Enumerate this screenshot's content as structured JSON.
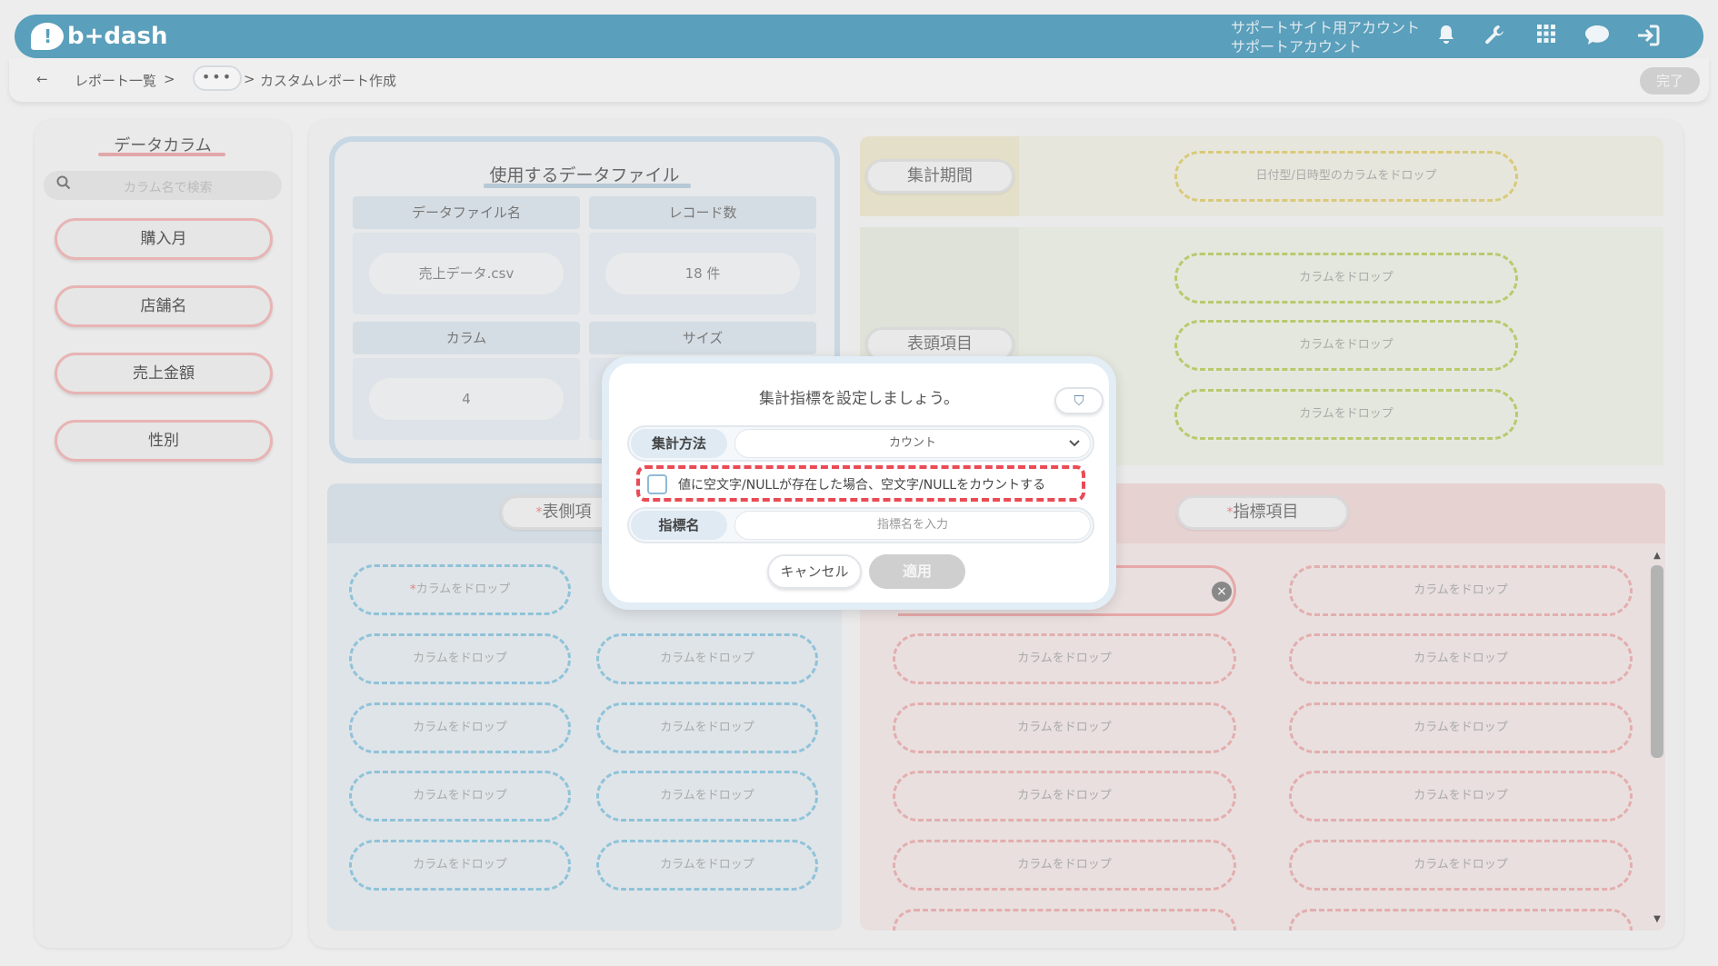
{
  "header": {
    "logo_text": "b+dash",
    "account_line1": "サポートサイト用アカウント",
    "account_line2": "サポートアカウント",
    "icons": [
      "bell-icon",
      "wrench-icon",
      "grid-icon",
      "chat-icon",
      "logout-icon"
    ],
    "brand_color": "#5a9fbb"
  },
  "breadcrumb": {
    "back_glyph": "←",
    "item1": "レポート一覧",
    "sep1": ">",
    "dots": "•••",
    "sep2": ">",
    "current": "カスタムレポート作成",
    "done_label": "完了"
  },
  "left_panel": {
    "title": "データカラム",
    "search_placeholder": "カラム名で検索",
    "columns": [
      "購入月",
      "店舗名",
      "売上金額",
      "性別"
    ]
  },
  "file_box": {
    "title": "使用するデータファイル",
    "head_filename": "データファイル名",
    "head_records": "レコード数",
    "filename": "売上データ.csv",
    "records": "18 件",
    "head_columns": "カラム",
    "head_size": "サイズ",
    "columns": "4"
  },
  "period": {
    "label": "集計期間",
    "drop_text": "日付型/日時型のカラムをドロップ"
  },
  "header_items": {
    "label": "表頭項目",
    "drop_text": "カラムをドロップ"
  },
  "row_items": {
    "required_mark": "*",
    "label": "表側項",
    "drop_text": "カラムをドロップ"
  },
  "metric_items": {
    "required_mark": "*",
    "label": "指標項目",
    "drop_text": "カラムをドロップ"
  },
  "modal": {
    "title": "集計指標を設定しましょう。",
    "beginner_glyph": "⛉",
    "method_label": "集計方法",
    "method_value": "カウント",
    "null_option_text": "値に空文字/NULLが存在した場合、空文字/NULLをカウントする",
    "null_option_checked": false,
    "name_label": "指標名",
    "name_placeholder": "指標名を入力",
    "cancel_label": "キャンセル",
    "apply_label": "適用",
    "highlight_color": "#ea4b55"
  }
}
